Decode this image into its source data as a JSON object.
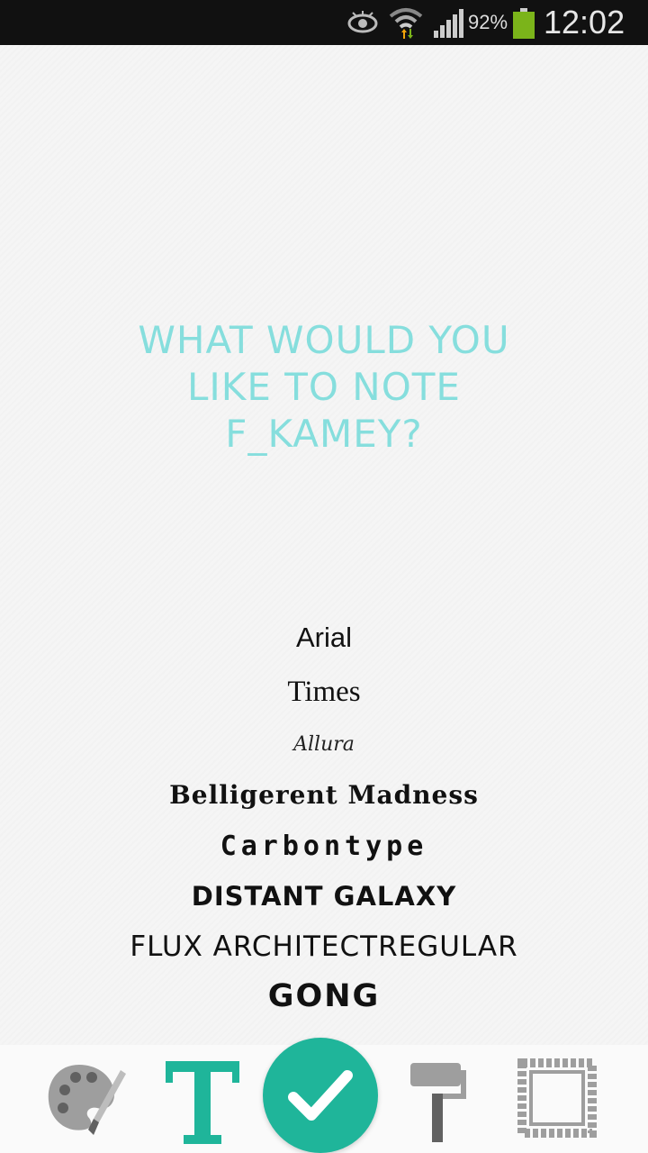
{
  "status_bar": {
    "battery_percent": "92%",
    "time": "12:02",
    "icons": [
      "eye-icon",
      "wifi-icon",
      "signal-icon",
      "battery-icon"
    ],
    "battery_color": "#7bb41a"
  },
  "prompt": {
    "text": "WHAT WOULD YOU LIKE TO NOTE F_KAMEY?",
    "color": "#86dedd"
  },
  "fonts": {
    "arial": "Arial",
    "times": "Times",
    "allura": "Allura",
    "belligerent": "Belligerent Madness",
    "carbontype": "Carbontype",
    "distant": "DISTANT GALAXY",
    "flux": "FLUX ARCHITECTREGULAR",
    "gong": "GONG"
  },
  "toolbar": {
    "tools": [
      "palette-icon",
      "text-icon",
      "paint-roller-icon",
      "frame-icon"
    ],
    "accent_color": "#1fb59a",
    "confirm_icon": "checkmark-icon"
  }
}
